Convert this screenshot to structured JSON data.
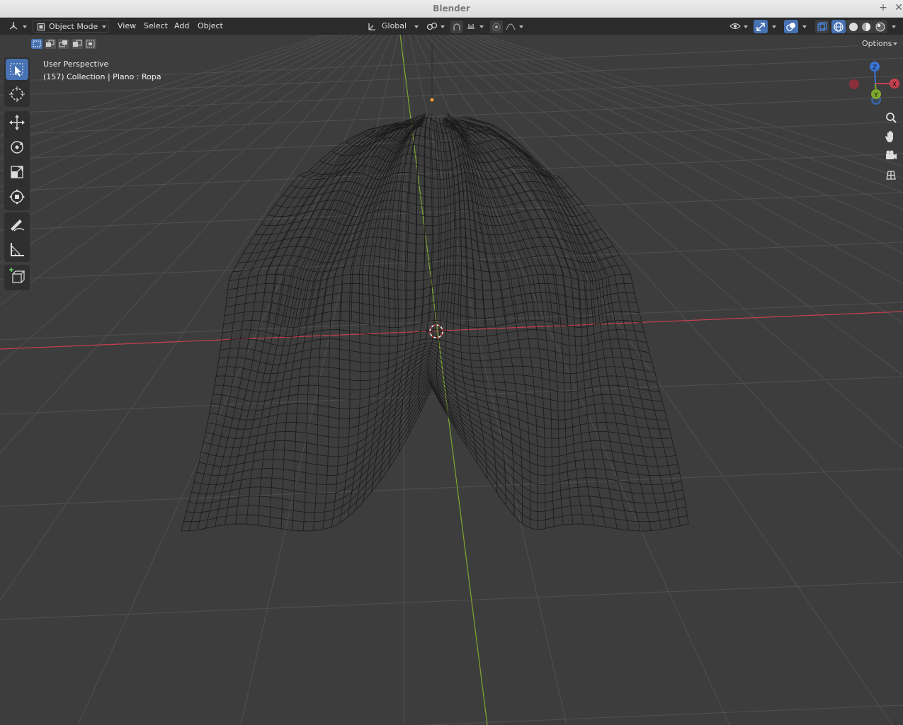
{
  "window": {
    "title": "Blender"
  },
  "header": {
    "editor_type_icon": "3d-viewport-icon",
    "mode": "Object Mode",
    "menus": [
      "View",
      "Select",
      "Add",
      "Object"
    ],
    "transform_orientation": "Global",
    "pivot_icon": "pivot-icon",
    "snap_icon": "snap-magnet-icon",
    "proportional_icon": "proportional-edit-icon"
  },
  "tool_settings": {
    "options_label": "Options"
  },
  "overlay": {
    "view_name": "User Perspective",
    "object_info": "(157) Collection | Plano : Ropa"
  },
  "gizmo": {
    "x_label": "X",
    "y_label": "Y",
    "z_label": "Z"
  },
  "colors": {
    "accent": "#4772b3",
    "x_axis": "#c8404f",
    "y_axis": "#7fa82e",
    "z_axis": "#3a75d6",
    "grid": "#555555",
    "background": "#3d3d3d"
  },
  "toolbar_tools": [
    "select-box-icon",
    "cursor-icon",
    "move-icon",
    "rotate-icon",
    "scale-icon",
    "transform-icon",
    "annotate-icon",
    "measure-icon",
    "add-cube-icon"
  ],
  "nav_gizmos": [
    "zoom-icon",
    "pan-hand-icon",
    "camera-icon",
    "ortho-grid-icon"
  ]
}
